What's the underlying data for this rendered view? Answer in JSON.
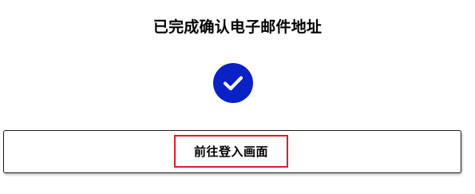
{
  "page": {
    "title": "已完成确认电子邮件地址"
  },
  "status": {
    "icon": "check-circle-icon",
    "color": "#0a21c5"
  },
  "actions": {
    "login_label": "前往登入画面",
    "highlight_color": "#e01b24"
  }
}
